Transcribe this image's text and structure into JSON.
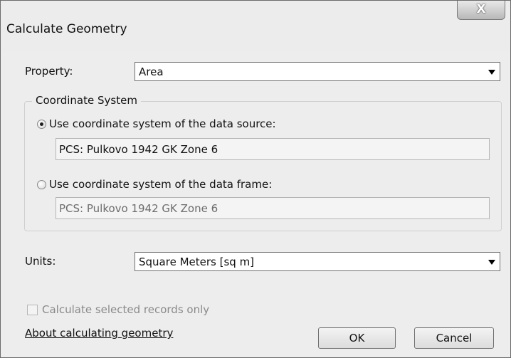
{
  "window": {
    "title": "Calculate Geometry",
    "close_glyph": "X"
  },
  "property": {
    "label": "Property:",
    "selected": "Area"
  },
  "coordinate_system": {
    "legend": "Coordinate System",
    "options": [
      {
        "label": "Use coordinate system of the data source:",
        "checked": true,
        "value": "PCS: Pulkovo 1942 GK Zone 6",
        "enabled": true
      },
      {
        "label": "Use coordinate system of the data frame:",
        "checked": false,
        "value": "PCS: Pulkovo 1942 GK Zone 6",
        "enabled": false
      }
    ]
  },
  "units": {
    "label": "Units:",
    "selected": "Square Meters [sq m]"
  },
  "selected_only": {
    "label": "Calculate selected records only",
    "checked": false,
    "enabled": false
  },
  "help_link": "About calculating geometry",
  "buttons": {
    "ok": "OK",
    "cancel": "Cancel"
  },
  "icons": {
    "close": "close-icon",
    "dropdown": "chevron-down-icon"
  }
}
